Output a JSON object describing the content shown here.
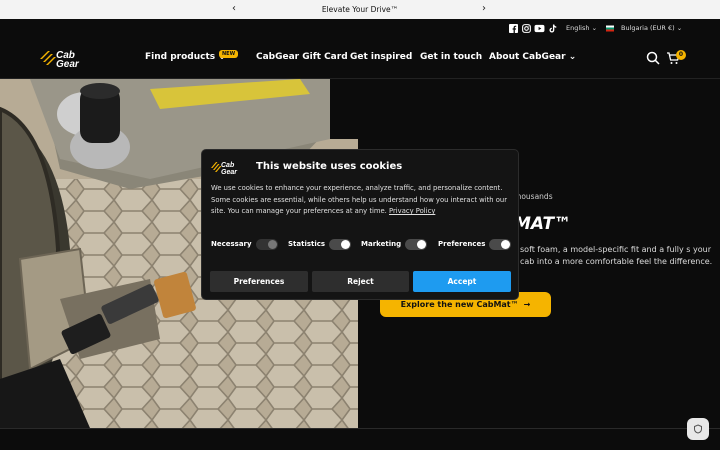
{
  "announcement": {
    "text": "Elevate Your Drive™"
  },
  "topbar": {
    "social": [
      "facebook-icon",
      "instagram-icon",
      "youtube-icon",
      "tiktok-icon"
    ],
    "language": "English",
    "currency": "Bulgaria (EUR €)"
  },
  "nav": {
    "logo_text": "CabGear",
    "links": [
      {
        "label": "Find products",
        "badge": "NEW"
      },
      {
        "label": "CabGear Gift Card"
      },
      {
        "label": "Get inspired"
      },
      {
        "label": "Get in touch"
      },
      {
        "label": "About CabGear"
      }
    ],
    "cart_count": "0"
  },
  "hero": {
    "eyebrow": "Thousands",
    "title": "MAT™",
    "body": "soft foam, a model-specific fit and a fully s your cab into a more comfortable feel the difference.",
    "cta": "Explore the new CabMat™"
  },
  "cookie": {
    "logo_text": "CabGear",
    "title": "This website uses cookies",
    "text": "We use cookies to enhance your experience, analyze traffic, and personalize content. Some cookies are essential, while others help us understand how you interact with our site. You can manage your preferences at any time.",
    "policy_link": "Privacy Policy",
    "toggles": [
      "Necessary",
      "Statistics",
      "Marketing",
      "Preferences"
    ],
    "buttons": {
      "preferences": "Preferences",
      "reject": "Reject",
      "accept": "Accept"
    }
  },
  "colors": {
    "accent": "#f5b400",
    "accept": "#1e9bf0",
    "background": "#0c0c0c"
  }
}
